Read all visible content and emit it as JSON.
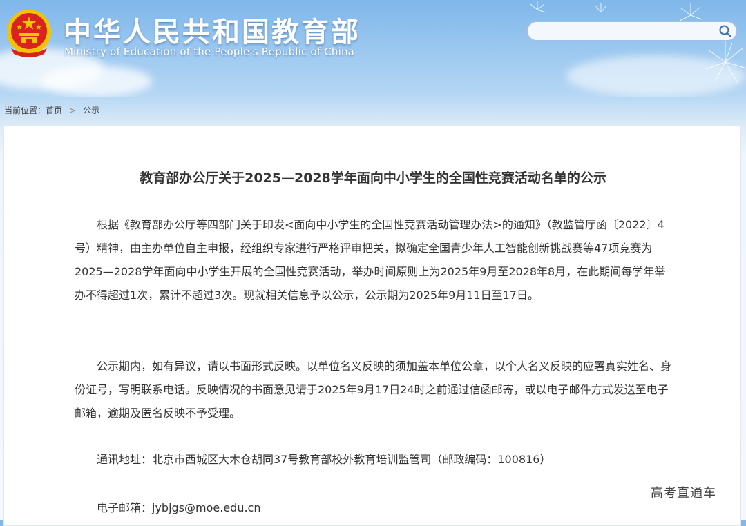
{
  "header": {
    "title": "中华人民共和国教育部",
    "subtitle": "Ministry of Education of the People's Republic of China",
    "search": {
      "value": "",
      "placeholder": ""
    }
  },
  "breadcrumb": {
    "label": "当前位置：",
    "items": [
      "首页",
      "公示"
    ],
    "separator": ">"
  },
  "article": {
    "title": "教育部办公厅关于2025—2028学年面向中小学生的全国性竞赛活动名单的公示",
    "paragraphs": [
      "根据《教育部办公厅等四部门关于印发<面向中小学生的全国性竞赛活动管理办法>的通知》（教监管厅函〔2022〕4号）精神，由主办单位自主申报，经组织专家进行严格评审把关，拟确定全国青少年人工智能创新挑战赛等47项竞赛为2025—2028学年面向中小学生开展的全国性竞赛活动，举办时间原则上为2025年9月至2028年8月，在此期间每学年举办不得超过1次，累计不超过3次。现就相关信息予以公示，公示期为2025年9月11日至17日。",
      "公示期内，如有异议，请以书面形式反映。以单位名义反映的须加盖本单位公章，以个人名义反映的应署真实姓名、身份证号，写明联系电话。反映情况的书面意见请于2025年9月17日24时之前通过信函邮寄，或以电子邮件方式发送至电子邮箱，逾期及匿名反映不予受理。",
      "通讯地址：北京市西城区大木仓胡同37号教育部校外教育培训监管司（邮政编码：100816）",
      "电子邮箱：jybjgs@moe.edu.cn"
    ]
  },
  "watermark": "高考直通车",
  "colors": {
    "sky_top": "#7fb7ea",
    "page_bg": "#f3f8fc",
    "emblem_red": "#d8241c",
    "emblem_gold": "#f5c400",
    "text": "#333333"
  },
  "icons": [
    "national-emblem-icon",
    "search-icon",
    "dandelion-icon"
  ]
}
